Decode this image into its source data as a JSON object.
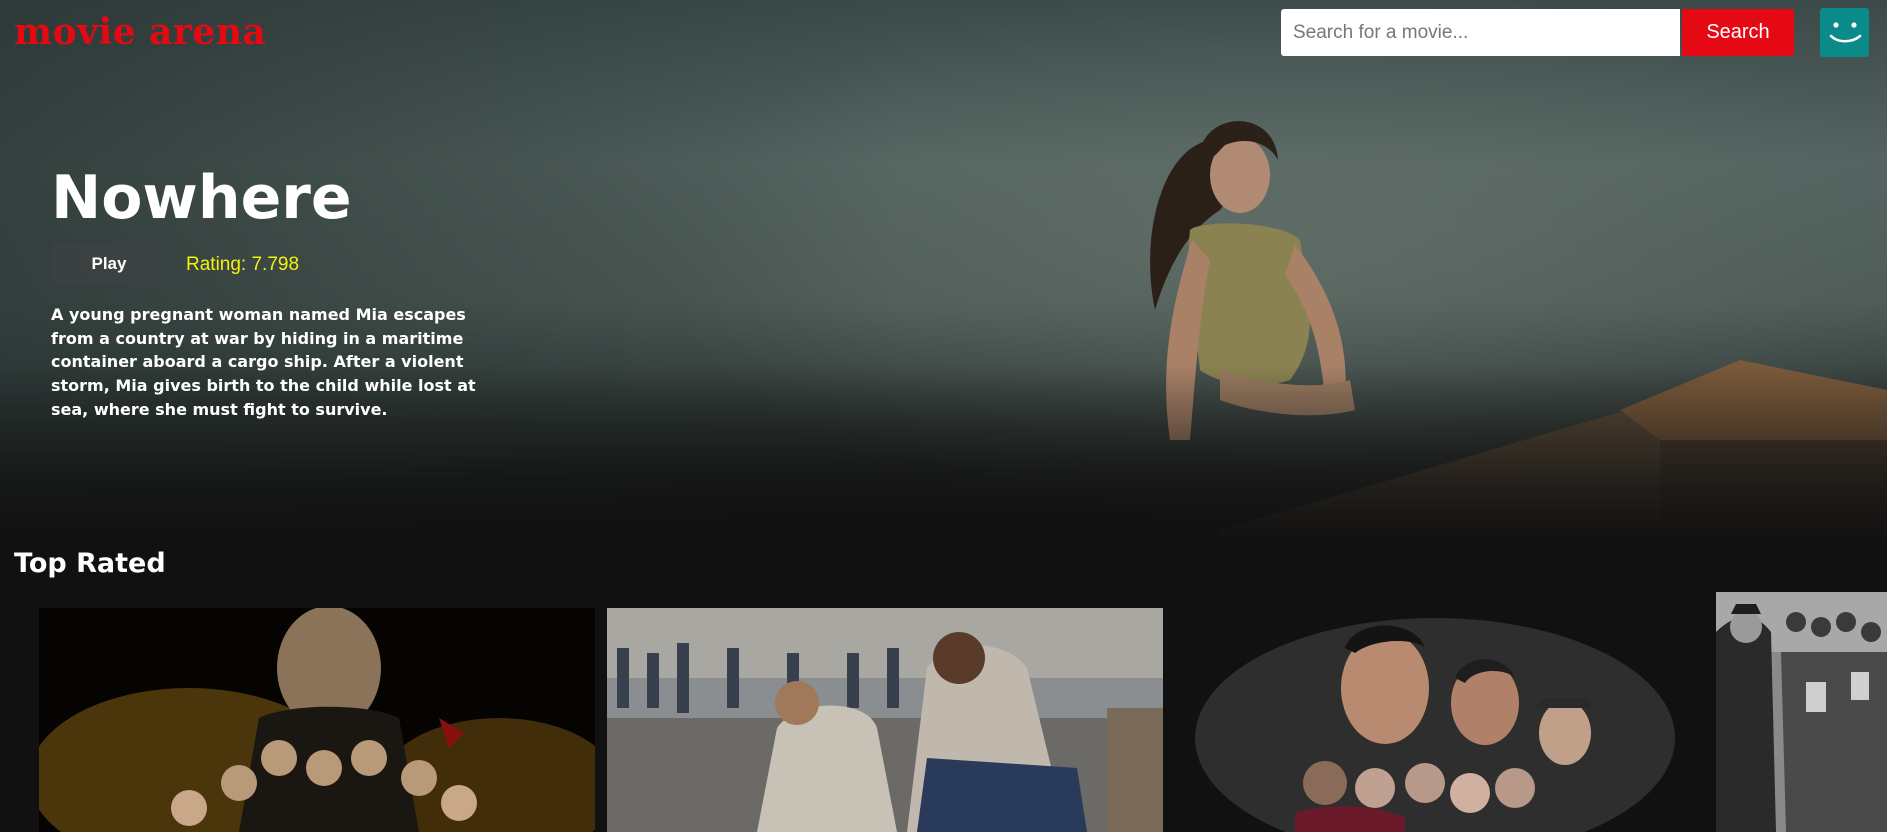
{
  "header": {
    "logo_text": "movie arena",
    "search": {
      "placeholder": "Search for a movie...",
      "value": "",
      "button_label": "Search"
    },
    "avatar_icon": "smiley-icon"
  },
  "hero": {
    "title": "Nowhere",
    "play_label": "Play",
    "rating_text": "Rating: 7.798",
    "description": "A young pregnant woman named Mia escapes from a country at war by hiding in a maritime container aboard a cargo ship. After a violent storm, Mia gives birth to the child while lost at sea, where she must fight to survive."
  },
  "rows": [
    {
      "title": "Top Rated",
      "posters": [
        {
          "name": "poster-1"
        },
        {
          "name": "poster-2"
        },
        {
          "name": "poster-3"
        },
        {
          "name": "poster-4"
        }
      ]
    }
  ],
  "colors": {
    "brand": "#e50914",
    "rating": "#f2f20a",
    "avatar": "#0b8a8a",
    "background": "#111111"
  }
}
